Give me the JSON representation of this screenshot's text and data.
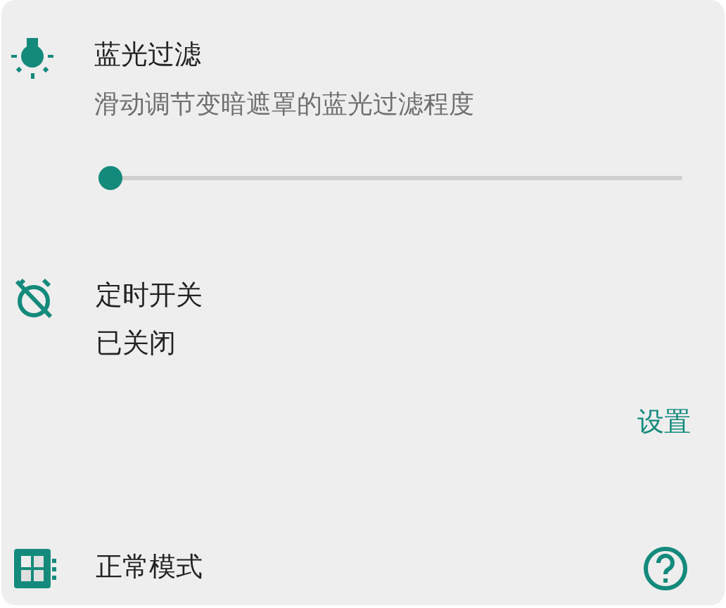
{
  "blue_filter": {
    "title": "蓝光过滤",
    "description": "滑动调节变暗遮罩的蓝光过滤程度",
    "slider": {
      "level": 0.0
    }
  },
  "timer": {
    "title": "定时开关",
    "status": "已关闭",
    "action": "设置"
  },
  "mode": {
    "label": "正常模式"
  }
}
